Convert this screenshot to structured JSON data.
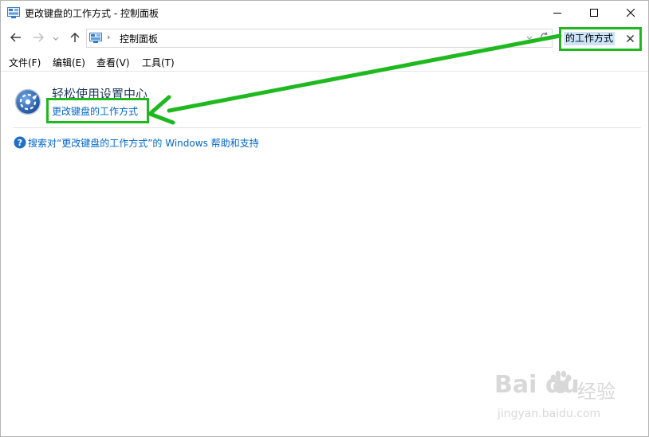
{
  "window": {
    "title": "更改键盘的工作方式 - 控制面板"
  },
  "address_bar": {
    "path": "控制面板"
  },
  "search": {
    "value": "的工作方式"
  },
  "menu": {
    "file": "文件(F)",
    "edit": "编辑(E)",
    "view": "查看(V)",
    "tools": "工具(T)"
  },
  "results": {
    "category_title": "轻松使用设置中心",
    "task_link": "更改键盘的工作方式",
    "help_link": "搜索对“更改键盘的工作方式”的 Windows 帮助和支持"
  },
  "annotation": {
    "highlight_color": "#1fb91f"
  },
  "watermark": {
    "brand": "Bai  du",
    "label": "经验",
    "url": "jingyan.baidu.com"
  },
  "icons": [
    "control-panel-icon",
    "minimize-icon",
    "maximize-icon",
    "close-icon",
    "back-arrow-icon",
    "forward-arrow-icon",
    "chevron-down-icon",
    "up-arrow-icon",
    "chevron-right-icon",
    "refresh-icon",
    "clear-icon",
    "ease-of-access-icon",
    "help-icon"
  ]
}
